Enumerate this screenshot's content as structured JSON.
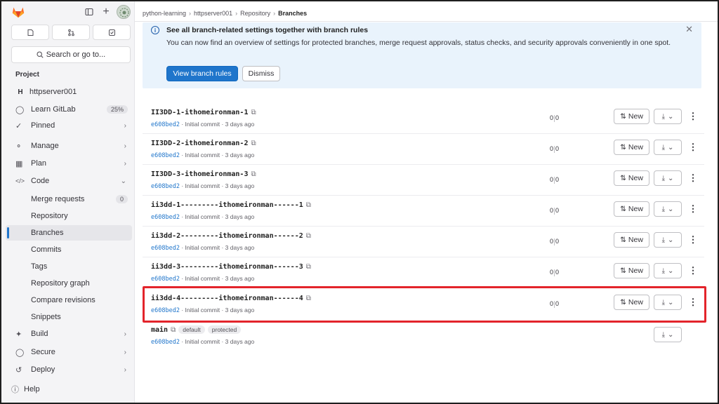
{
  "breadcrumb": [
    "python-learning",
    "httpserver001",
    "Repository",
    "Branches"
  ],
  "sidebar": {
    "search_label": "Search or go to...",
    "section_label": "Project",
    "project_initial": "H",
    "project_name": "httpserver001",
    "items": [
      {
        "label": "Learn GitLab",
        "badge": "25%"
      },
      {
        "label": "Pinned"
      },
      {
        "label": "Manage"
      },
      {
        "label": "Plan"
      },
      {
        "label": "Code"
      },
      {
        "label": "Merge requests",
        "count": "0"
      },
      {
        "label": "Repository"
      },
      {
        "label": "Branches"
      },
      {
        "label": "Commits"
      },
      {
        "label": "Tags"
      },
      {
        "label": "Repository graph"
      },
      {
        "label": "Compare revisions"
      },
      {
        "label": "Snippets"
      },
      {
        "label": "Build"
      },
      {
        "label": "Secure"
      },
      {
        "label": "Deploy"
      }
    ],
    "help_label": "Help"
  },
  "alert": {
    "title": "See all branch-related settings together with branch rules",
    "body": "You can now find an overview of settings for protected branches, merge request approvals, status checks, and security approvals conveniently in one spot.",
    "primary_button": "View branch rules",
    "dismiss_button": "Dismiss"
  },
  "branch_actions": {
    "new_label": "New"
  },
  "branches": [
    {
      "name": "II3DD-1-ithomeironman-1",
      "sha": "e608bed2",
      "meta": " · Initial commit · 3 days ago",
      "behind": "0",
      "ahead": "0"
    },
    {
      "name": "II3DD-2-ithomeironman-2",
      "sha": "e608bed2",
      "meta": " · Initial commit · 3 days ago",
      "behind": "0",
      "ahead": "0"
    },
    {
      "name": "II3DD-3-ithomeironman-3",
      "sha": "e608bed2",
      "meta": " · Initial commit · 3 days ago",
      "behind": "0",
      "ahead": "0"
    },
    {
      "name": "ii3dd-1---------ithomeironman------1",
      "sha": "e608bed2",
      "meta": " · Initial commit · 3 days ago",
      "behind": "0",
      "ahead": "0"
    },
    {
      "name": "ii3dd-2---------ithomeironman------2",
      "sha": "e608bed2",
      "meta": " · Initial commit · 3 days ago",
      "behind": "0",
      "ahead": "0"
    },
    {
      "name": "ii3dd-3---------ithomeironman------3",
      "sha": "e608bed2",
      "meta": " · Initial commit · 3 days ago",
      "behind": "0",
      "ahead": "0"
    },
    {
      "name": "ii3dd-4---------ithomeironman------4",
      "sha": "e608bed2",
      "meta": " · Initial commit · 3 days ago",
      "behind": "0",
      "ahead": "0"
    },
    {
      "name": "main",
      "sha": "e608bed2",
      "meta": " · Initial commit · 3 days ago",
      "badges": [
        "default",
        "protected"
      ]
    }
  ],
  "colors": {
    "accent": "#1f75cb",
    "highlight": "#e3242b",
    "alert_bg": "#e9f3fc"
  }
}
